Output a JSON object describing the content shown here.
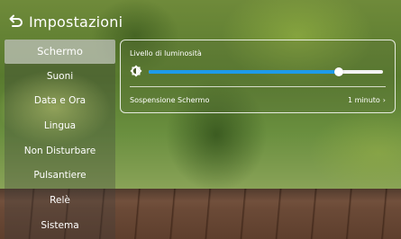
{
  "header": {
    "title": "Impostazioni",
    "back_icon": "back-arrow-icon"
  },
  "sidebar": {
    "items": [
      {
        "label": "Schermo",
        "active": true
      },
      {
        "label": "Suoni"
      },
      {
        "label": "Data e Ora"
      },
      {
        "label": "Lingua"
      },
      {
        "label": "Non Disturbare"
      },
      {
        "label": "Pulsantiere"
      },
      {
        "label": "Relè"
      },
      {
        "label": "Sistema"
      }
    ]
  },
  "screen_settings": {
    "brightness_label": "Livello di luminosità",
    "brightness_icon": "brightness-icon",
    "brightness_value": 0.81,
    "sleep_label": "Sospensione Schermo",
    "sleep_value": "1 minuto",
    "sleep_chevron": "›"
  },
  "colors": {
    "accent": "#1e9bea",
    "active_item_bg": "#d9d9d9"
  }
}
